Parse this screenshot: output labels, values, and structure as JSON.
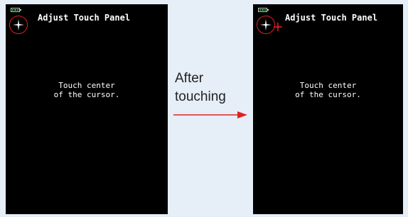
{
  "left_screen": {
    "title": "Adjust Touch Panel",
    "instruction_line1": "Touch center",
    "instruction_line2": "of the cursor."
  },
  "right_screen": {
    "title": "Adjust Touch Panel",
    "instruction_line1": "Touch center",
    "instruction_line2": "of the cursor."
  },
  "transition": {
    "line1": "After",
    "line2": "touching"
  },
  "colors": {
    "screen_bg": "#000000",
    "page_bg": "#e6eef8",
    "accent_red": "#e02020",
    "battery_green": "#2ecc2e"
  },
  "icons": [
    "battery-icon",
    "crosshair-cursor-icon",
    "touch-mark-icon",
    "right-arrow-icon"
  ]
}
